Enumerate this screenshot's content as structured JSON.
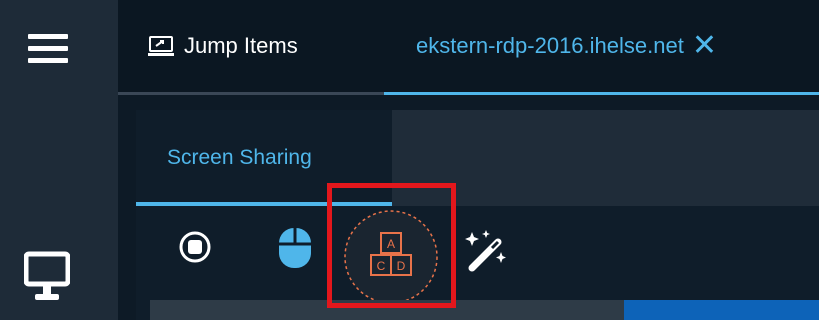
{
  "sidebar": {
    "menu_icon": "hamburger-menu-icon",
    "monitor_icon": "monitor-icon"
  },
  "tabs": {
    "jump_items": {
      "label": "Jump Items",
      "icon": "jump-items-icon"
    },
    "session": {
      "label": "ekstern-rdp-2016.ihelse.net",
      "close_icon": "close-icon",
      "close_glyph": "✕"
    }
  },
  "panel": {
    "subtab_label": "Screen Sharing"
  },
  "toolbar": {
    "items": [
      "stop-icon",
      "mouse-icon",
      "special-keys-icon",
      "magic-wand-icon"
    ],
    "special_keys_letters": [
      "A",
      "C",
      "D"
    ]
  },
  "colors": {
    "accent": "#4fb6ea",
    "highlight": "#e3171c",
    "keys_orange": "#e8734a",
    "sidebar": "#1e2b38",
    "background": "#0d1a26"
  }
}
